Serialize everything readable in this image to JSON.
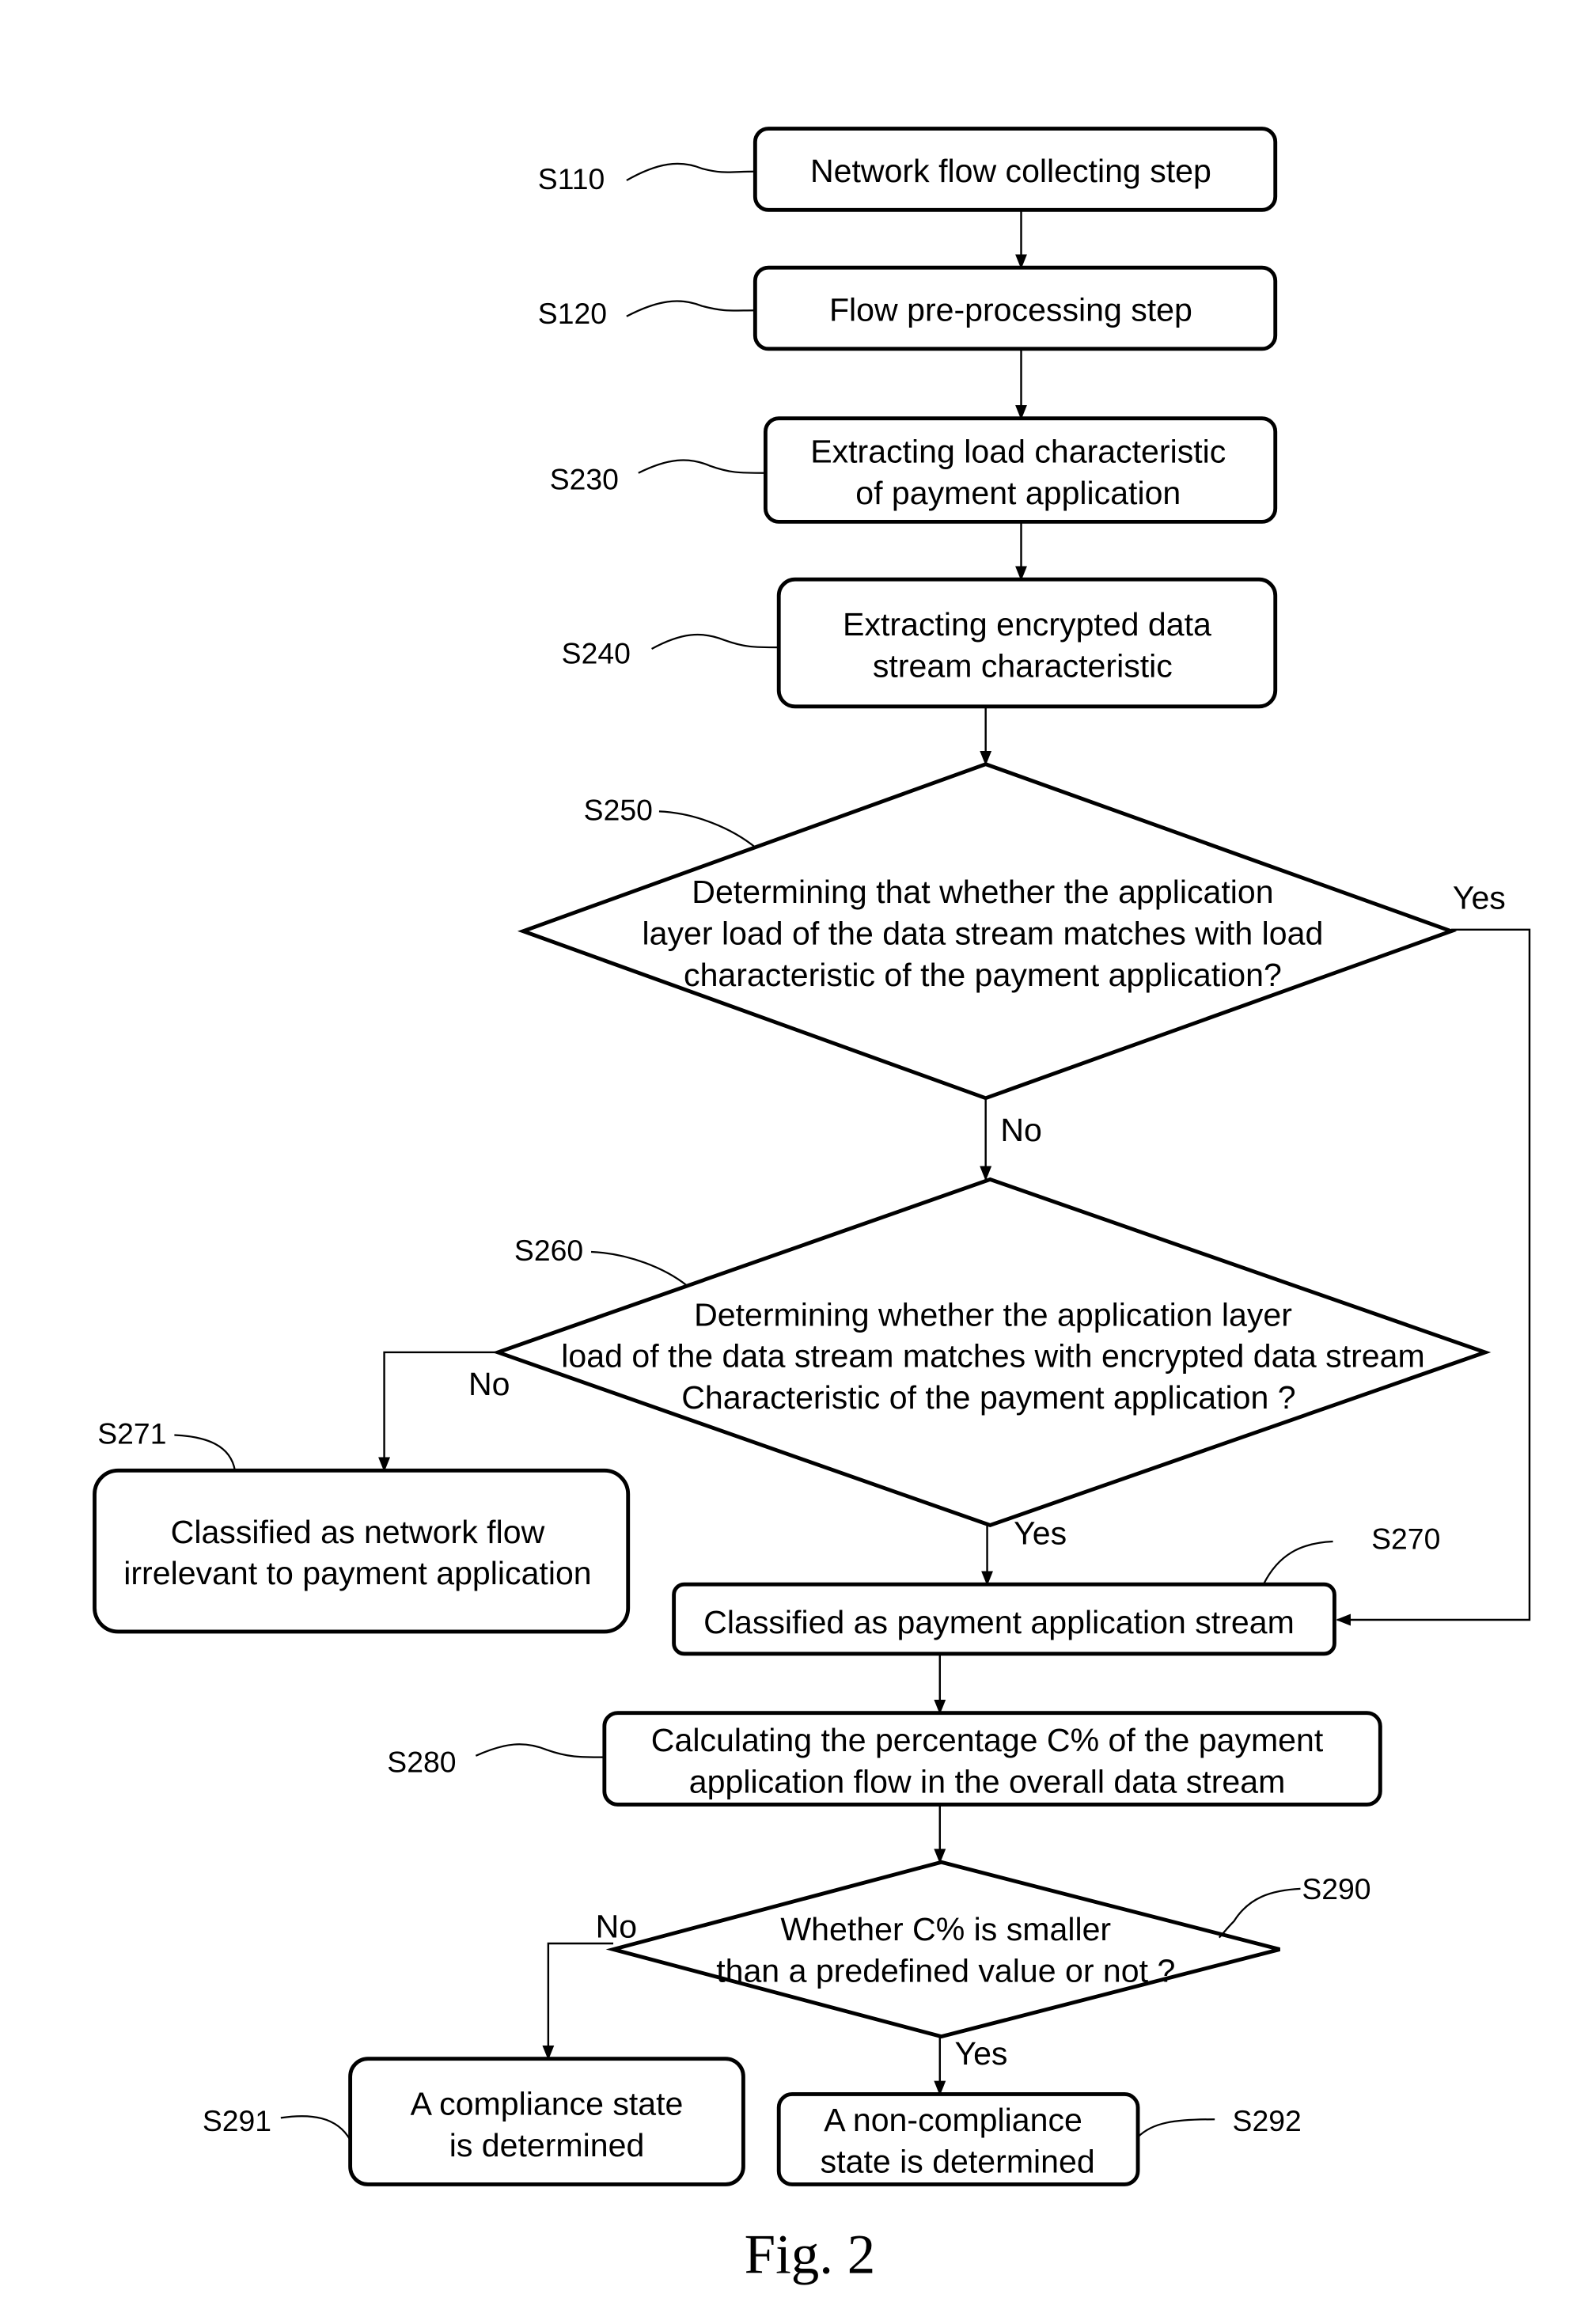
{
  "figure_caption": "Fig. 2",
  "steps": {
    "s110": {
      "id": "S110",
      "lines": [
        "Network flow collecting step"
      ]
    },
    "s120": {
      "id": "S120",
      "lines": [
        "Flow pre-processing step"
      ]
    },
    "s230": {
      "id": "S230",
      "lines": [
        "Extracting load characteristic",
        "of payment application"
      ]
    },
    "s240": {
      "id": "S240",
      "lines": [
        "Extracting encrypted data",
        "stream characteristic"
      ]
    },
    "s250": {
      "id": "S250",
      "lines": [
        "Determining that whether the application",
        "layer load of the data stream matches with load",
        "characteristic of the payment application?"
      ]
    },
    "s260": {
      "id": "S260",
      "lines": [
        "Determining whether the application layer",
        "load of the data stream matches with encrypted data stream",
        "Characteristic of the payment application ?"
      ]
    },
    "s271": {
      "id": "S271",
      "lines": [
        "Classified as network flow",
        "irrelevant to payment application"
      ]
    },
    "s270": {
      "id": "S270",
      "lines": [
        "Classified as payment application stream"
      ]
    },
    "s280": {
      "id": "S280",
      "lines": [
        "Calculating the percentage C% of the payment",
        "application flow in the overall data stream"
      ]
    },
    "s290": {
      "id": "S290",
      "lines": [
        "Whether C% is smaller",
        "than a predefined value or not ?"
      ]
    },
    "s291": {
      "id": "S291",
      "lines": [
        "A compliance state",
        "is determined"
      ]
    },
    "s292": {
      "id": "S292",
      "lines": [
        "A non-compliance",
        "state is determined"
      ]
    }
  },
  "branches": {
    "s250_yes": "Yes",
    "s250_no": "No",
    "s260_no": "No",
    "s260_yes": "Yes",
    "s290_no": "No",
    "s290_yes": "Yes"
  }
}
